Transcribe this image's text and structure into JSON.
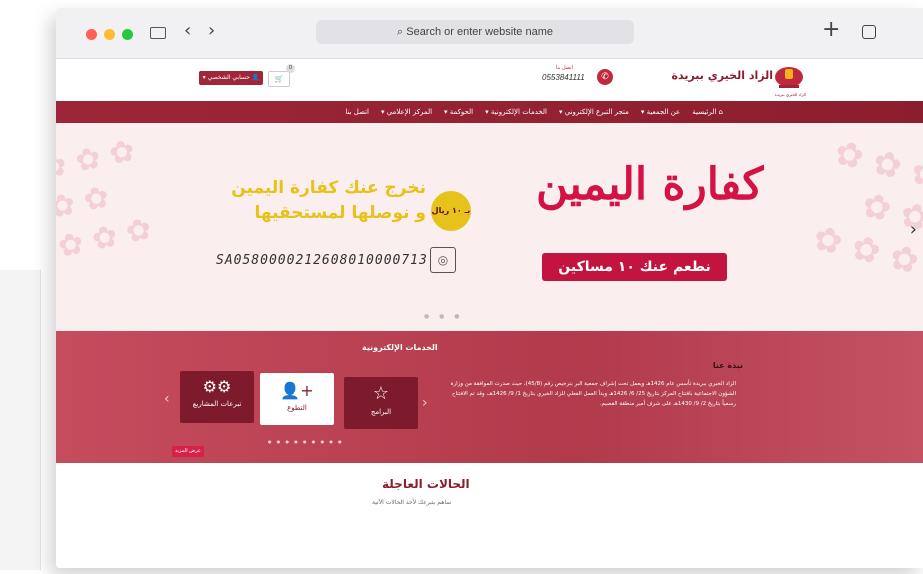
{
  "browser": {
    "url_placeholder": "Search or enter website name"
  },
  "header": {
    "org_name": "الزاد الخيري ببريدة",
    "logo_caption": "الزاد الخيري ببريدة",
    "contact_label": "اتصل بنا",
    "contact_phone": "0553841111",
    "account_label": "حسابي الشخصي",
    "cart_count": "0"
  },
  "nav": {
    "items": [
      "الرئيسية",
      "عن الجمعية",
      "متجر التبرع الإلكتروني",
      "الخدمات الإلكترونية",
      "الحوكمة",
      "المركز الإعلامي",
      "اتصل بنا"
    ]
  },
  "hero": {
    "headline": "كفارة اليمين",
    "subline": "نطعم عنك ١٠ مساكين",
    "slogan_line1": "نخرج عنك كفارة اليمين",
    "slogan_line2": "و نوصلها لمستحقيها",
    "price_badge": "بـ ١٠ ريال",
    "iban": "SA0580000212608010000713"
  },
  "services": {
    "title": "الخدمات الإلكترونية",
    "cards": [
      {
        "label": "البرامج",
        "icon": "star-icon"
      },
      {
        "label": "التطوع",
        "icon": "add-user-icon"
      },
      {
        "label": "تبرعات المشاريع",
        "icon": "gears-icon"
      }
    ],
    "more_label": "عرض المزيد"
  },
  "about": {
    "title": "نبذة عنا",
    "text": "الزاد الخيري ببريدة تأسس عام 1426هـ ويعمل تحت إشراف جمعية البر بترخيص رقم (45/8)، حيث صدرت الموافقة من وزارة الشؤون الاجتماعية بافتتاح المركز بتاريخ 25/ 6/ 1426هـ وبدأ العمل الفعلي للزاد الخيري بتاريخ 1/ 9/ 1426هـ، وقد تم الافتتاح رسمياً بتاريخ 2/ 9/ 1430هـ على شرف أمير منطقة القصيم."
  },
  "urgent": {
    "title": "الحالات العاجلة",
    "subtitle": "ساهم بتبرعك لأحد الحالات الآتية"
  },
  "colors": {
    "brand": "#9c2637",
    "accent_yellow": "#e6c21a",
    "hero_red": "#d31245"
  }
}
